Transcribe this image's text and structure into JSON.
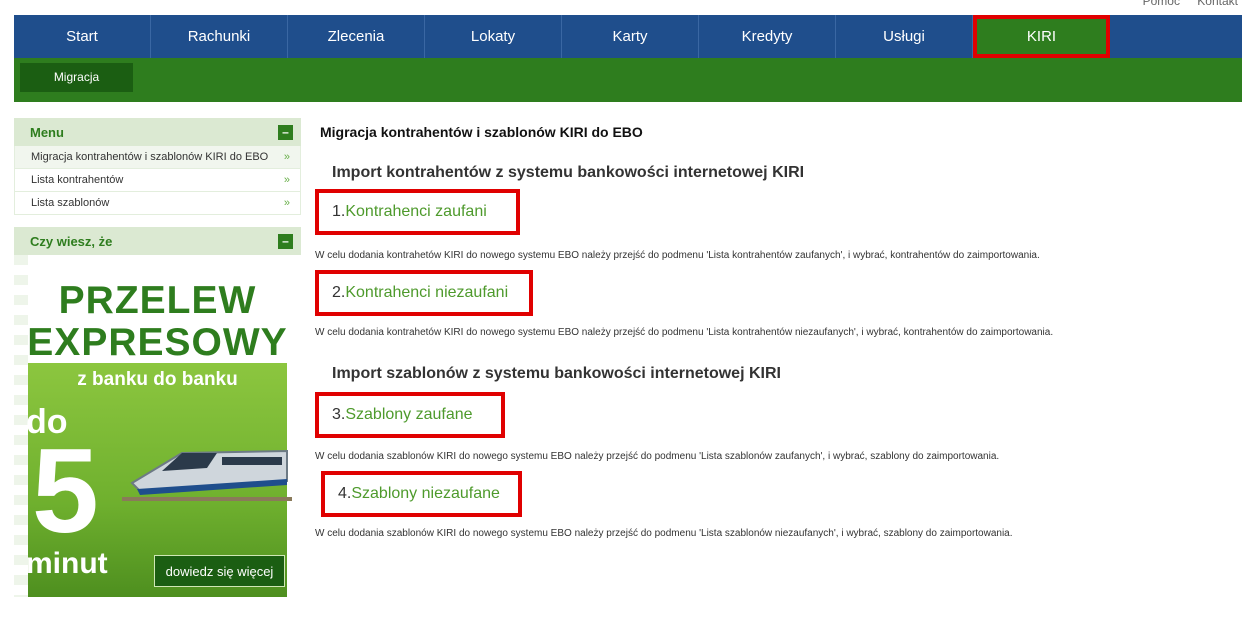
{
  "top_links": {
    "help": "Pomoc",
    "contact": "Kontakt"
  },
  "main_nav": [
    {
      "label": "Start"
    },
    {
      "label": "Rachunki"
    },
    {
      "label": "Zlecenia"
    },
    {
      "label": "Lokaty"
    },
    {
      "label": "Karty"
    },
    {
      "label": "Kredyty"
    },
    {
      "label": "Usługi"
    },
    {
      "label": "KIRI"
    }
  ],
  "sub_nav": {
    "label": "Migracja"
  },
  "sidebar": {
    "menu": {
      "title": "Menu",
      "toggle": "–",
      "items": [
        {
          "label": "Migracja kontrahentów i szablonów KIRI do EBO",
          "arrow": "»"
        },
        {
          "label": "Lista kontrahentów",
          "arrow": "»"
        },
        {
          "label": "Lista szablonów",
          "arrow": "»"
        }
      ]
    },
    "did_you_know": {
      "title": "Czy wiesz, że",
      "toggle": "–",
      "banner": {
        "line1": "PRZELEW",
        "line2": "EXPRESOWY",
        "line3": "z banku do banku",
        "do": "do",
        "five": "5",
        "minut": "minut",
        "cta": "dowiedz się więcej"
      }
    }
  },
  "content": {
    "page_title": "Migracja kontrahentów i szablonów KIRI do EBO",
    "section1_title": "Import kontrahentów z systemu bankowości internetowej KIRI",
    "link1": {
      "num": "1.",
      "label": "Kontrahenci zaufani"
    },
    "desc1": "W celu dodania kontrahetów KIRI do nowego systemu EBO należy przejść do podmenu 'Lista kontrahentów zaufanych', i wybrać, kontrahentów do zaimportowania.",
    "link2": {
      "num": "2.",
      "label": "Kontrahenci niezaufani"
    },
    "desc2": "W celu dodania kontrahetów KIRI do nowego systemu EBO należy przejść do podmenu 'Lista kontrahentów niezaufanych', i wybrać, kontrahentów do zaimportowania.",
    "section2_title": "Import szablonów z systemu bankowości internetowej KIRI",
    "link3": {
      "num": "3.",
      "label": "Szablony zaufane"
    },
    "desc3": "W celu dodania szablonów KIRI do nowego systemu EBO należy przejść do podmenu 'Lista szablonów zaufanych', i wybrać, szablony do zaimportowania.",
    "link4": {
      "num": "4.",
      "label": "Szablony niezaufane"
    },
    "desc4": "W celu dodania szablonów KIRI do nowego systemu EBO należy przejść do podmenu 'Lista szablonów niezaufanych', i wybrać, szablony do zaimportowania."
  },
  "colors": {
    "nav_blue": "#1f4e8c",
    "brand_green": "#2e7d1e",
    "link_green": "#4e9a2c",
    "highlight_red": "#e00000"
  }
}
